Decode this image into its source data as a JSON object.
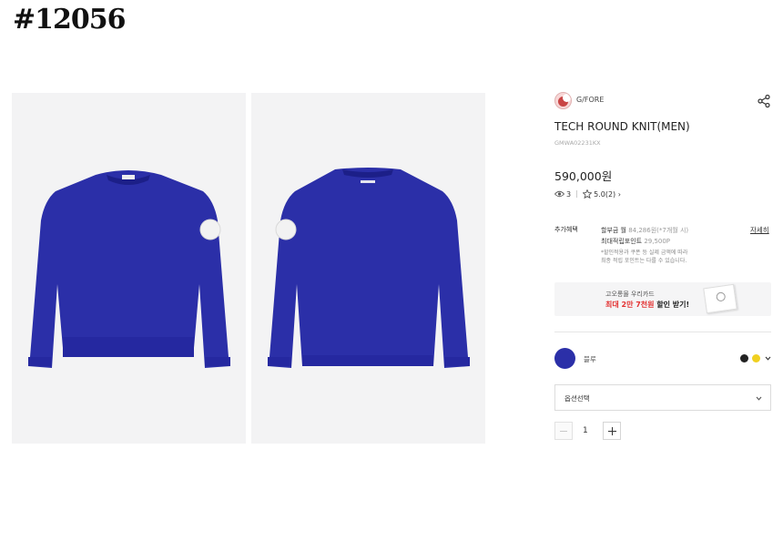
{
  "page_id": "#12056",
  "product": {
    "brand": "G/FORE",
    "title": "TECH ROUND KNIT(MEN)",
    "code": "GMWA02231KX",
    "price": "590,000원",
    "views": "3",
    "rating": "5.0(2)",
    "rating_arrow": "›",
    "images": [
      {
        "view": "front",
        "color": "#2b2fa8"
      },
      {
        "view": "back",
        "color": "#2b2fa8"
      }
    ]
  },
  "benefits": {
    "label": "추가혜택",
    "installment_prefix": "할부금 월 ",
    "installment_value": "84,286원(*7개월 시)",
    "points_prefix": "최대적립포인트 ",
    "points_value": "29,500P",
    "note_line1": "*할인적용과 쿠폰 등 실제 금액에 따라",
    "note_line2": "최종 적립 포인트는 다를 수 있습니다.",
    "detail_link": "자세히"
  },
  "banner": {
    "line1": "고오롱몰 우리카드",
    "line2_highlight": "최대 2만 7천원",
    "line2_rest": " 할인 받기!"
  },
  "color_option": {
    "selected_name": "블루",
    "selected_color": "#2b2fa8",
    "other_colors": [
      "#222222",
      "#f0d020"
    ]
  },
  "option_select": {
    "placeholder": "옵션선택"
  },
  "quantity": {
    "value": "1"
  },
  "icons": {
    "share": "share-icon",
    "views": "eye-icon",
    "rating": "star-icon",
    "chevron": "chevron-down-icon"
  }
}
